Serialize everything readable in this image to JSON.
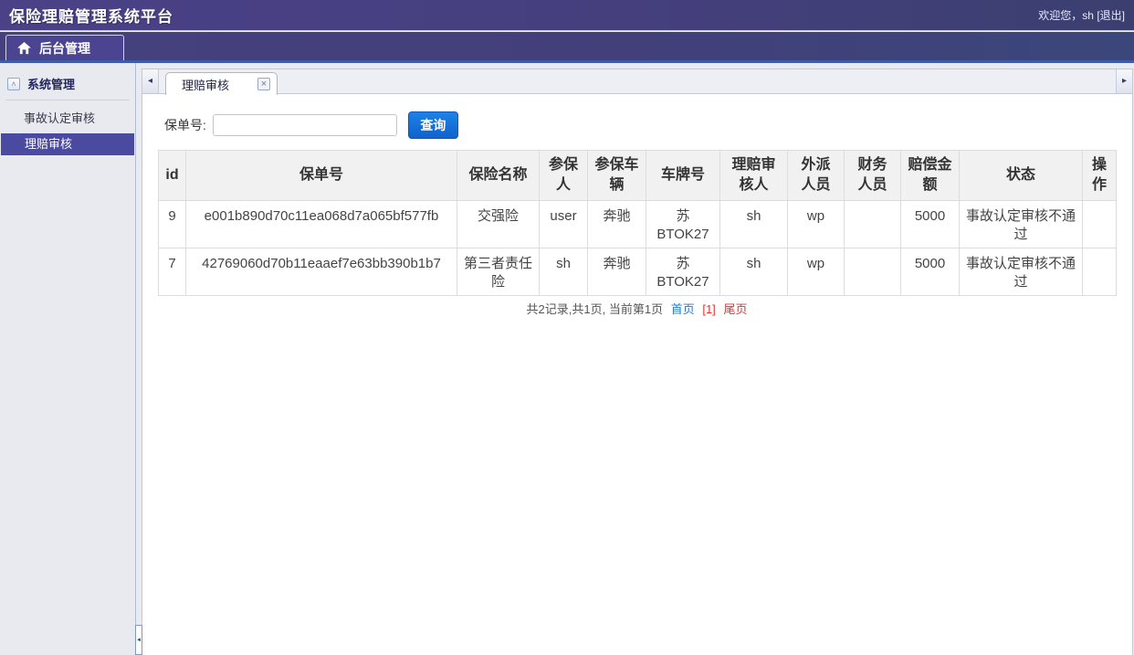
{
  "header": {
    "title": "保险理赔管理系统平台",
    "welcome": "欢迎您，",
    "username": "sh",
    "logout": "[退出]"
  },
  "nav": {
    "tab": "后台管理"
  },
  "sidebar": {
    "panel_title": "系统管理",
    "items": [
      {
        "label": "事故认定审核"
      },
      {
        "label": "理赔审核"
      }
    ]
  },
  "tabstrip": {
    "active_tab": "理赔审核"
  },
  "search": {
    "label": "保单号:",
    "value": "",
    "button": "查询"
  },
  "table": {
    "columns": [
      "id",
      "保单号",
      "保险名称",
      "参保人",
      "参保车辆",
      "车牌号",
      "理赔审核人",
      "外派人员",
      "财务人员",
      "赔偿金额",
      "状态",
      "操作"
    ],
    "rows": [
      [
        "9",
        "e001b890d70c11ea068d7a065bf577fb",
        "交强险",
        "user",
        "奔驰",
        "苏BTOK27",
        "sh",
        "wp",
        "",
        "5000",
        "事故认定审核不通过",
        ""
      ],
      [
        "7",
        "42769060d70b11eaaef7e63bb390b1b7",
        "第三者责任险",
        "sh",
        "奔驰",
        "苏BTOK27",
        "sh",
        "wp",
        "",
        "5000",
        "事故认定审核不通过",
        ""
      ]
    ]
  },
  "pagination": {
    "summary": "共2记录,共1页, 当前第1页",
    "first": "首页",
    "current": "[1]",
    "last": "尾页"
  },
  "icons": {
    "panel_collapse": "˄",
    "tab_close": "×",
    "scroll_left": "◂",
    "scroll_right": "▸",
    "sidebar_collapse": "◄"
  },
  "colors": {
    "topbar_purple": "#453f7e",
    "nav_border_blue": "#3f5da6",
    "selected_item_purple": "#4a4aa0",
    "button_blue": "#1470d8",
    "link_blue": "#2279d5",
    "link_red": "#e03333"
  }
}
